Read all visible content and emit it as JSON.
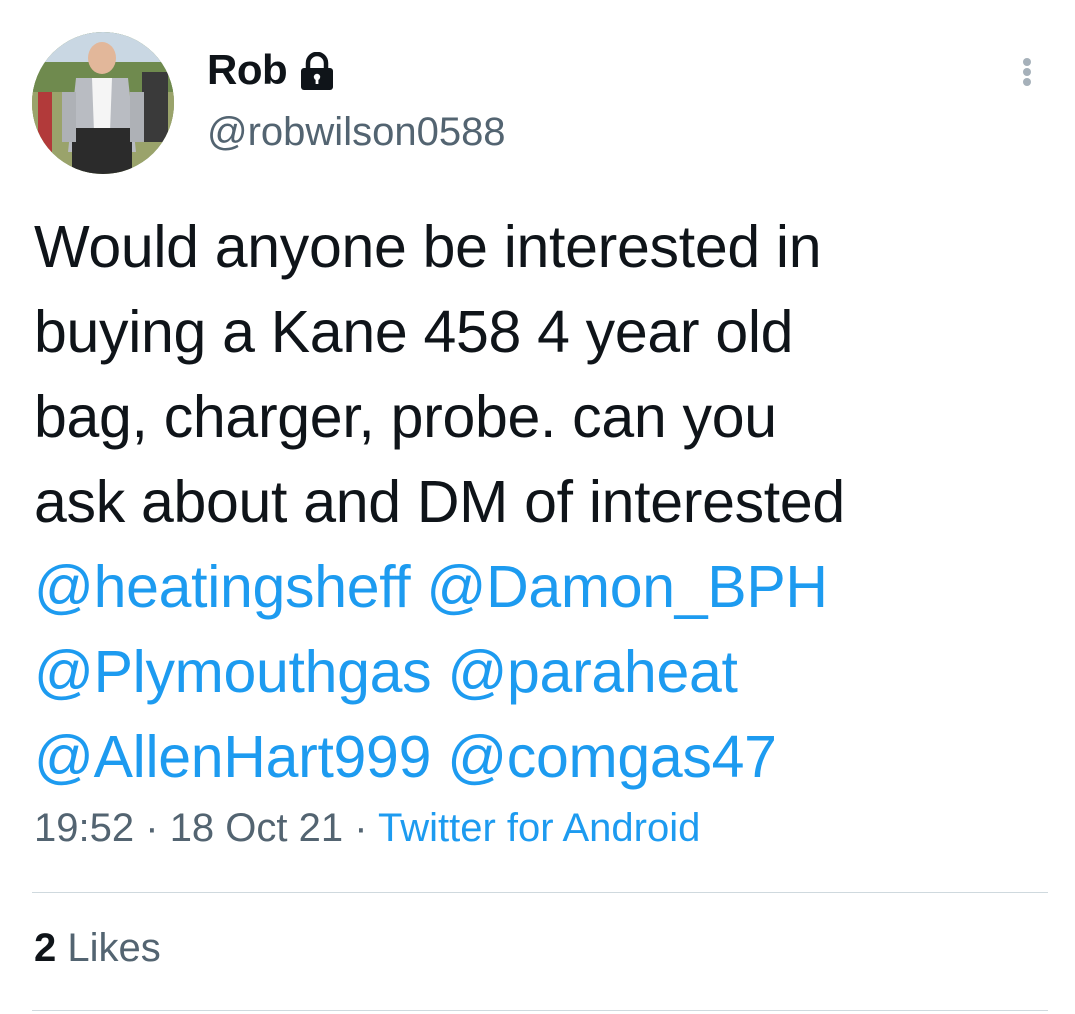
{
  "author": {
    "display_name": "Rob",
    "handle": "@robwilson0588",
    "protected": true,
    "avatar_icon": "person-photo-avatar"
  },
  "tweet": {
    "lines": [
      "Would anyone be interested in",
      "buying a Kane 458 4 year old",
      "bag, charger, probe. can you",
      "ask about and DM of interested"
    ],
    "mentions": [
      [
        "@heatingsheff",
        "@Damon_BPH"
      ],
      [
        "@Plymouthgas",
        "@paraheat"
      ],
      [
        "@AllenHart999",
        "@comgas47"
      ]
    ]
  },
  "meta": {
    "time": "19:52",
    "separator": "·",
    "date": "18 Oct 21",
    "source": "Twitter for Android"
  },
  "engagement": {
    "likes_count": "2",
    "likes_label": "Likes"
  },
  "colors": {
    "text": "#0f1419",
    "secondary": "#536471",
    "link": "#1d9bf0",
    "divider": "#cfd9de"
  },
  "icons": {
    "lock": "lock-icon",
    "more": "more-vertical-icon"
  }
}
